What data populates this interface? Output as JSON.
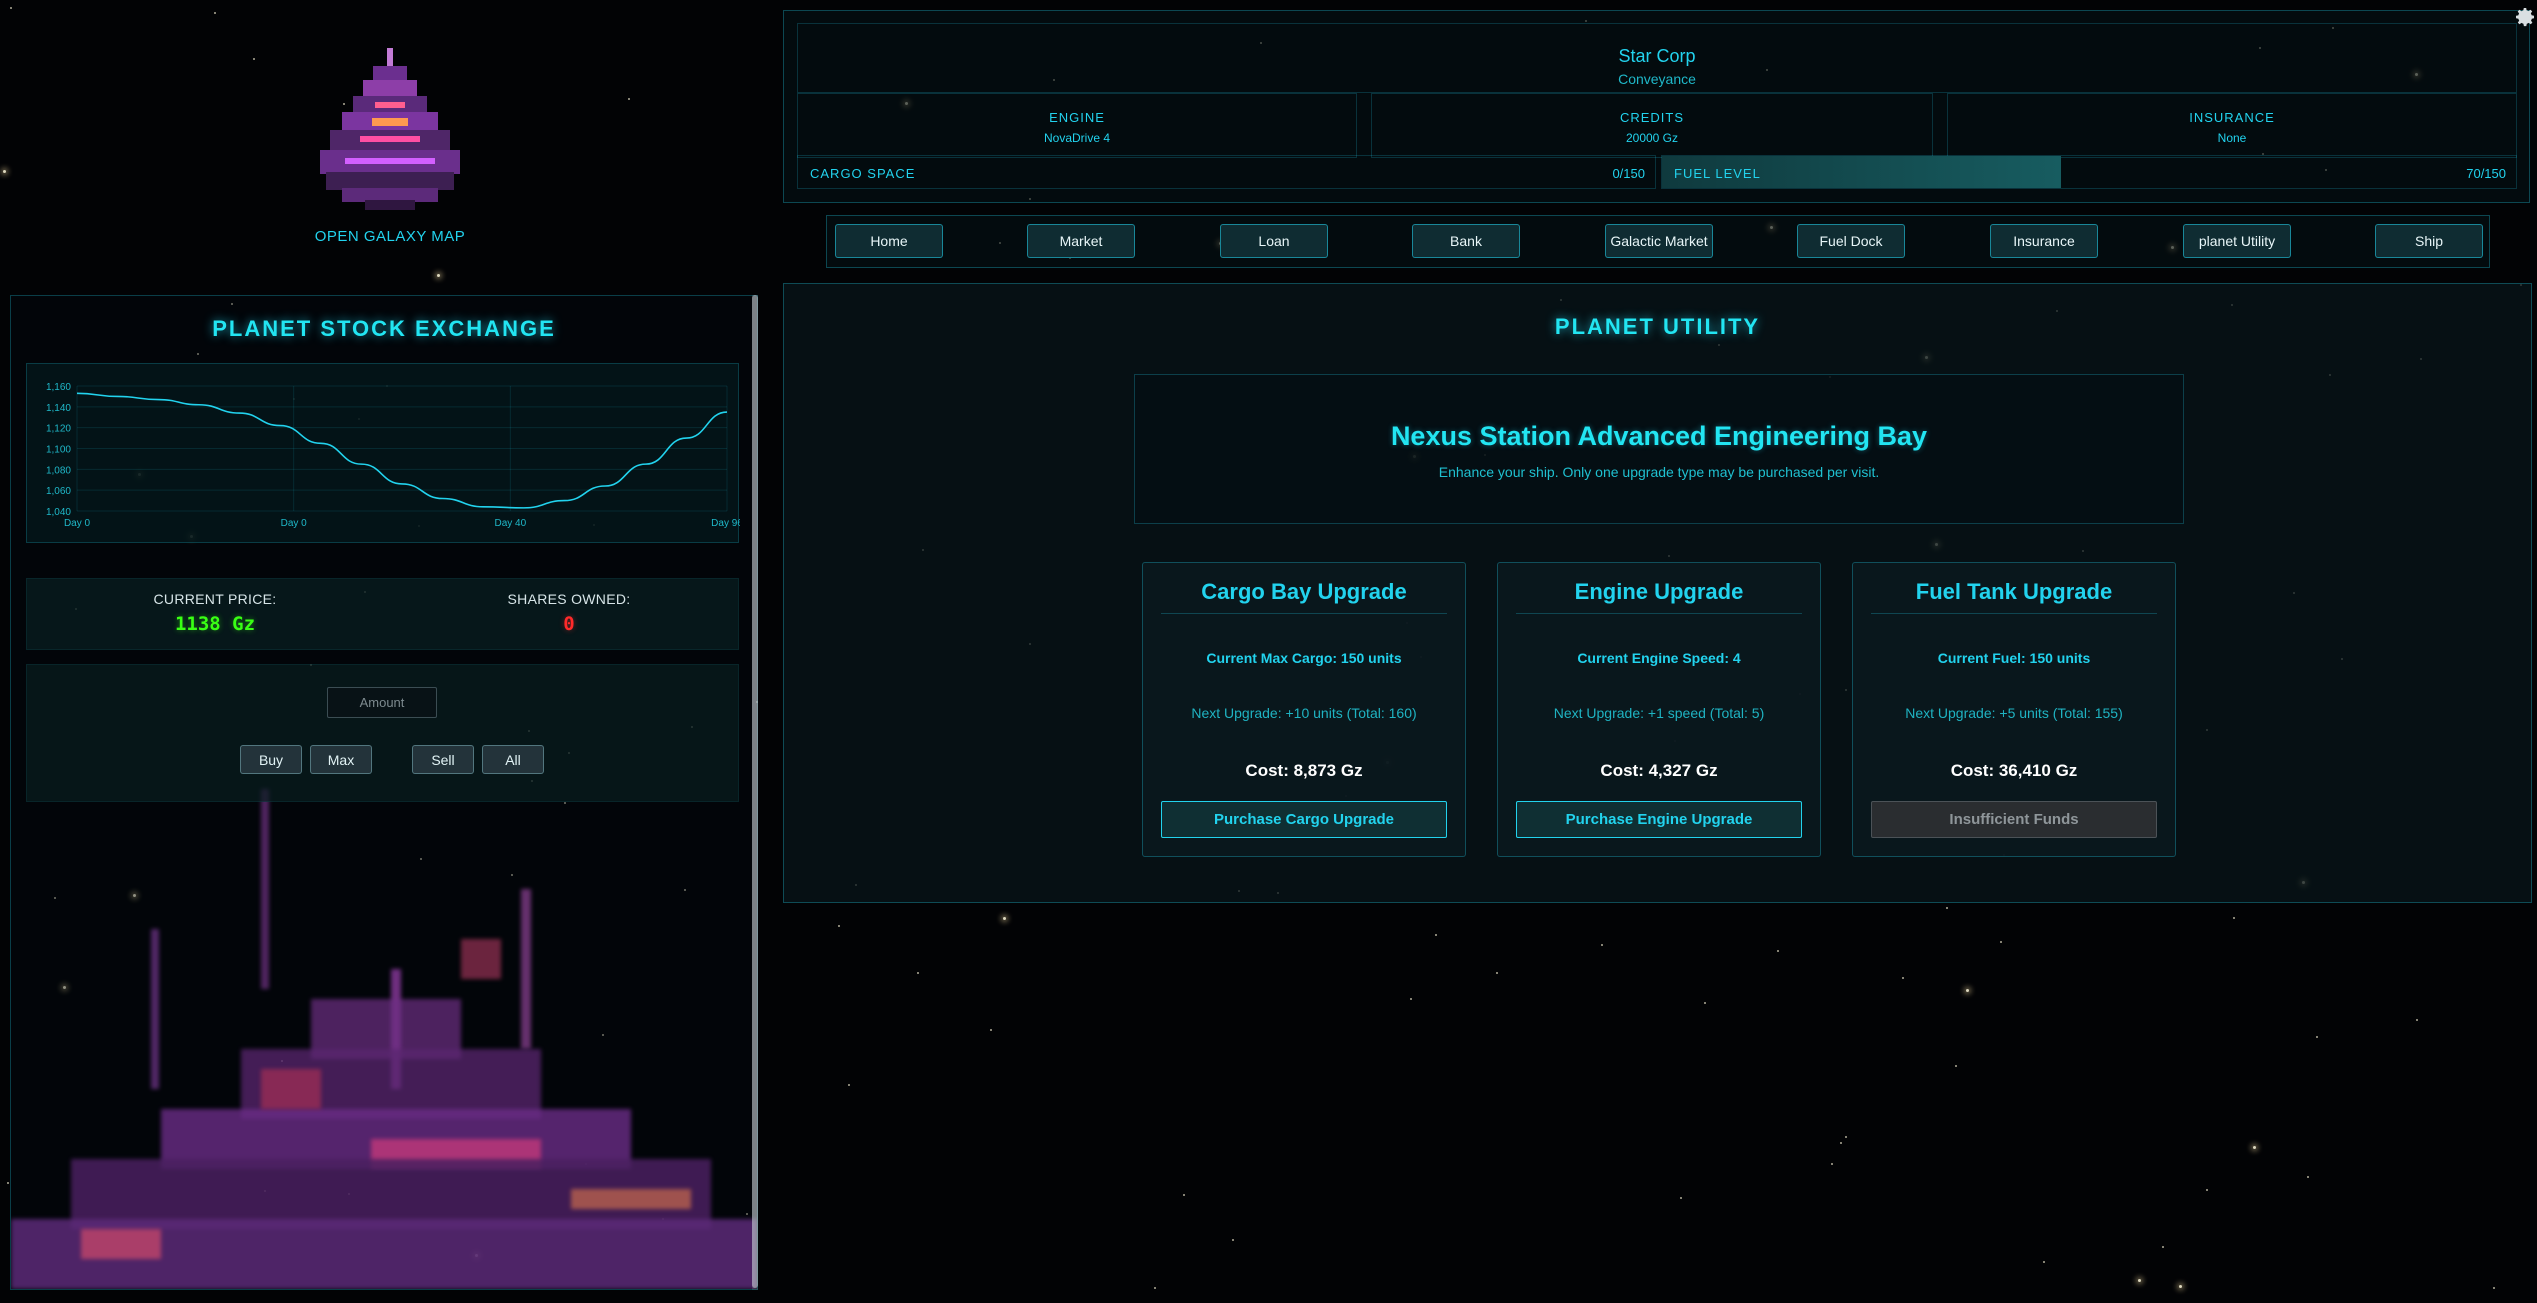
{
  "galaxy_map": {
    "label": "OPEN GALAXY MAP"
  },
  "stock_exchange": {
    "title": "PLANET STOCK EXCHANGE",
    "current_price_label": "CURRENT PRICE:",
    "current_price": "1138 Gz",
    "shares_owned_label": "SHARES OWNED:",
    "shares_owned": "0",
    "amount_placeholder": "Amount",
    "buttons": {
      "buy": "Buy",
      "max": "Max",
      "sell": "Sell",
      "all": "All"
    }
  },
  "chart_data": {
    "type": "line",
    "x_tick_labels": [
      "Day 0",
      "Day 0",
      "Day 40",
      "Day 96"
    ],
    "y_tick_labels": [
      "1,160",
      "1,140",
      "1,120",
      "1,100",
      "1,080",
      "1,060",
      "1,040"
    ],
    "ylim": [
      1040,
      1160
    ],
    "grid": true,
    "line_color": "#22d3ee",
    "series": [
      {
        "values": [
          1153,
          1150,
          1147,
          1142,
          1134,
          1122,
          1105,
          1085,
          1066,
          1052,
          1044,
          1043,
          1050,
          1064,
          1085,
          1110,
          1135
        ]
      }
    ]
  },
  "header": {
    "company_name": "Star Corp",
    "company_subtitle": "Conveyance",
    "stats": [
      {
        "label": "ENGINE",
        "value": "NovaDrive 4"
      },
      {
        "label": "CREDITS",
        "value": "20000 Gz"
      },
      {
        "label": "INSURANCE",
        "value": "None"
      }
    ],
    "cargo": {
      "label": "CARGO SPACE",
      "value": "0/150",
      "fraction": 0.0
    },
    "fuel": {
      "label": "FUEL LEVEL",
      "value": "70/150",
      "fraction": 0.4667
    }
  },
  "nav": {
    "items": [
      "Home",
      "Market",
      "Loan",
      "Bank",
      "Galactic Market",
      "Fuel Dock",
      "Insurance",
      "planet Utility",
      "Ship"
    ]
  },
  "utility": {
    "title": "PLANET UTILITY",
    "bay_title": "Nexus Station Advanced Engineering Bay",
    "bay_desc": "Enhance your ship. Only one upgrade type may be purchased per visit.",
    "cards": [
      {
        "title": "Cargo Bay Upgrade",
        "current": "Current Max Cargo: 150 units",
        "next": "Next Upgrade: +10 units (Total: 160)",
        "cost": "Cost: 8,873 Gz",
        "button": "Purchase Cargo Upgrade"
      },
      {
        "title": "Engine Upgrade",
        "current": "Current Engine Speed: 4",
        "next": "Next Upgrade: +1 speed (Total: 5)",
        "cost": "Cost: 4,327 Gz",
        "button": "Purchase Engine Upgrade"
      },
      {
        "title": "Fuel Tank Upgrade",
        "current": "Current Fuel: 150 units",
        "next": "Next Upgrade: +5 units (Total: 155)",
        "cost": "Cost: 36,410 Gz",
        "button": "Insufficient Funds"
      }
    ]
  },
  "colors": {
    "accent": "#22d3ee",
    "price_positive": "#39ff14",
    "shares_zero": "#ff2a2a"
  },
  "icons": {
    "settings": "gear-icon"
  }
}
